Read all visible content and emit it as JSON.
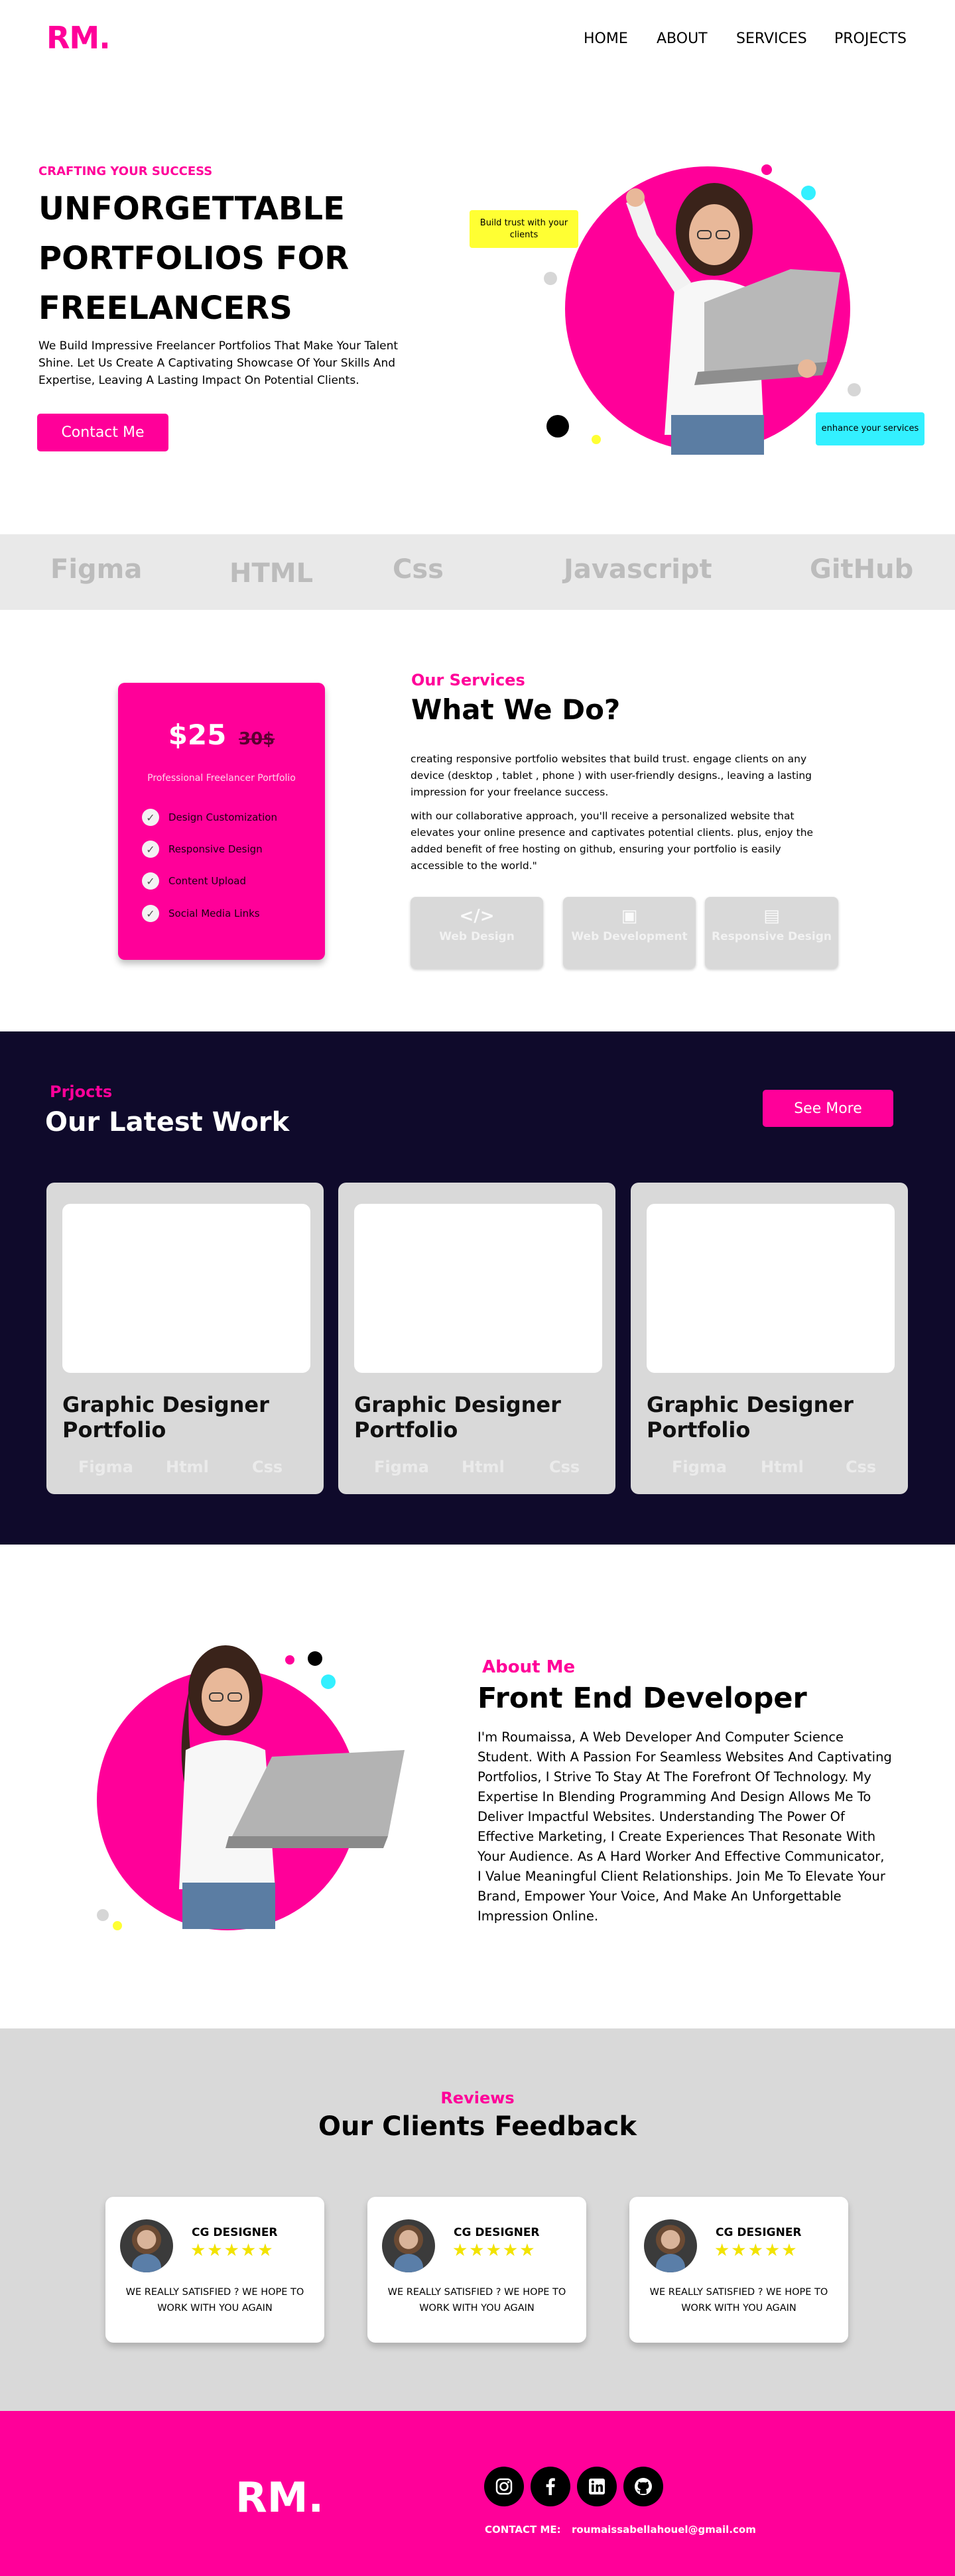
{
  "brand": {
    "logo": "RM.",
    "accent": "#ff0099",
    "dark": "#0f0a2b"
  },
  "nav": {
    "items": [
      "HOME",
      "ABOUT",
      "SERVICES",
      "PROJECTS"
    ]
  },
  "hero": {
    "eyebrow": "CRAFTING YOUR SUCCESS",
    "title": "UNFORGETTABLE PORTFOLIOS FOR FREELANCERS",
    "description": "We Build Impressive Freelancer Portfolios That Make Your Talent Shine. Let Us Create A Captivating Showcase Of Your Skills And Expertise, Leaving A Lasting Impact On Potential Clients.",
    "cta": "Contact Me",
    "bubble_trust": "Build trust with your clients",
    "bubble_enhance": "enhance your services"
  },
  "skills": [
    "Figma",
    "HTML",
    "Css",
    "Javascript",
    "GitHub"
  ],
  "pricing": {
    "price": "$25",
    "old_price": "30$",
    "subtitle": "Professional Freelancer Portfolio",
    "features": [
      "Design Customization",
      "Responsive Design",
      "Content Upload",
      "Social Media Links"
    ]
  },
  "services": {
    "eyebrow": "Our Services",
    "title": "What We Do?",
    "paragraph1": "creating responsive portfolio websites that build trust. engage clients on any device (desktop , tablet , phone ) with user-friendly designs., leaving a lasting impression for your freelance success.",
    "paragraph2": " with our collaborative approach, you'll receive a personalized website that elevates your online presence and captivates potential clients. plus, enjoy the added benefit of free hosting on github, ensuring your portfolio is easily accessible to the world.\"",
    "tiles": [
      {
        "label": "Web Design",
        "icon": "code-icon"
      },
      {
        "label": "Web Development",
        "icon": "devices-icon"
      },
      {
        "label": "Responsive Design",
        "icon": "responsive-icon"
      }
    ]
  },
  "projects": {
    "eyebrow": "Prjocts",
    "title": "Our Latest Work",
    "see_more": "See More",
    "cards": [
      {
        "name": "Graphic Designer Portfolio",
        "tags": [
          "Figma",
          "Html",
          "Css"
        ]
      },
      {
        "name": "Graphic Designer Portfolio",
        "tags": [
          "Figma",
          "Html",
          "Css"
        ]
      },
      {
        "name": "Graphic Designer Portfolio",
        "tags": [
          "Figma",
          "Html",
          "Css"
        ]
      }
    ]
  },
  "about": {
    "eyebrow": "About Me",
    "title": "Front End Developer",
    "body": "I'm Roumaissa, A Web Developer And Computer Science Student. With A Passion For Seamless Websites And Captivating Portfolios, I Strive To Stay At The Forefront Of Technology. My Expertise In Blending Programming And Design Allows Me To Deliver Impactful Websites. Understanding The Power Of Effective Marketing, I Create Experiences That Resonate With Your Audience. As A Hard Worker And Effective Communicator, I Value Meaningful Client Relationships. Join Me To Elevate Your Brand, Empower Your Voice, And Make An Unforgettable Impression Online."
  },
  "reviews": {
    "eyebrow": "Reviews",
    "title": "Our Clients Feedback",
    "cards": [
      {
        "name": "CG DESIGNER",
        "stars": "★★★★★",
        "text": "WE REALLY SATISFIED ? WE HOPE TO WORK WITH YOU AGAIN"
      },
      {
        "name": "CG DESIGNER",
        "stars": "★★★★★",
        "text": "WE REALLY SATISFIED ? WE HOPE TO WORK WITH YOU AGAIN"
      },
      {
        "name": "CG DESIGNER",
        "stars": "★★★★★",
        "text": "WE REALLY SATISFIED ? WE HOPE TO WORK WITH YOU AGAIN"
      }
    ]
  },
  "footer": {
    "logo": "RM.",
    "socials": [
      "instagram-icon",
      "facebook-icon",
      "linkedin-icon",
      "github-icon"
    ],
    "contact_label": "CONTACT ME:",
    "contact_email": "roumaissabellahouel@gmail.com"
  }
}
